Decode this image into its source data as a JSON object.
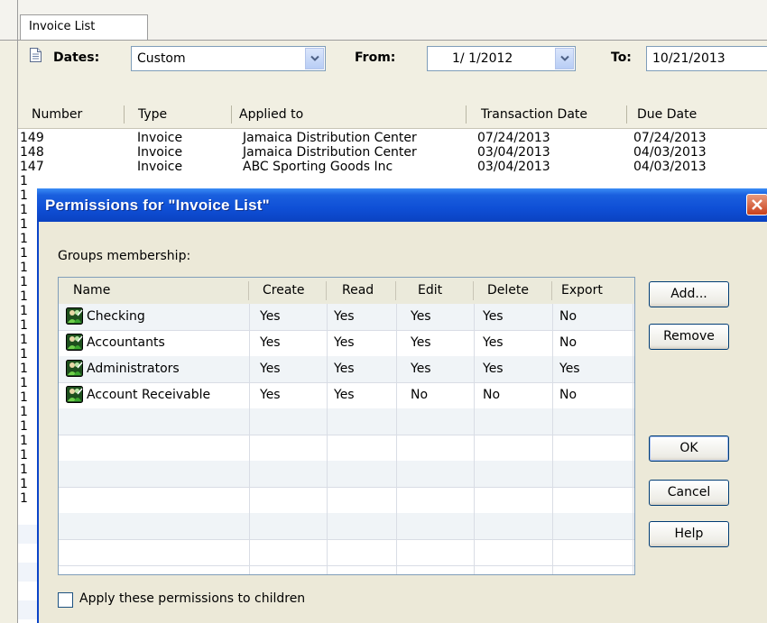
{
  "app": {
    "tab_label": "Invoice List",
    "toolbar": {
      "dates_label": "Dates:",
      "dates_value": "Custom",
      "from_label": "From:",
      "from_value": "1/ 1/2012",
      "to_label": "To:",
      "to_value": "10/21/2013"
    },
    "grid": {
      "columns": [
        "Number",
        "Type",
        "Applied to",
        "Transaction Date",
        "Due Date"
      ],
      "rows": [
        [
          "149",
          "Invoice",
          "Jamaica Distribution Center",
          "07/24/2013",
          "07/24/2013"
        ],
        [
          "148",
          "Invoice",
          "Jamaica Distribution Center",
          "03/04/2013",
          "04/03/2013"
        ],
        [
          "147",
          "Invoice",
          "ABC Sporting Goods Inc",
          "03/04/2013",
          "04/03/2013"
        ]
      ],
      "hidden_row_stub": "1"
    }
  },
  "dialog": {
    "title": "Permissions for \"Invoice List\"",
    "groups_label": "Groups membership:",
    "columns": [
      "Name",
      "Create",
      "Read",
      "Edit",
      "Delete",
      "Export"
    ],
    "rows": [
      {
        "name": "Checking",
        "create": "Yes",
        "read": "Yes",
        "edit": "Yes",
        "delete": "Yes",
        "export": "No"
      },
      {
        "name": "Accountants",
        "create": "Yes",
        "read": "Yes",
        "edit": "Yes",
        "delete": "Yes",
        "export": "No"
      },
      {
        "name": "Administrators",
        "create": "Yes",
        "read": "Yes",
        "edit": "Yes",
        "delete": "Yes",
        "export": "Yes"
      },
      {
        "name": "Account Receivable",
        "create": "Yes",
        "read": "Yes",
        "edit": "No",
        "delete": "No",
        "export": "No"
      }
    ],
    "buttons": {
      "add": "Add...",
      "remove": "Remove",
      "ok": "OK",
      "cancel": "Cancel",
      "help": "Help"
    },
    "apply_children_label": "Apply these permissions to children",
    "apply_children_checked": false
  },
  "colors": {
    "titlebar": "#0f4fd6",
    "close": "#c9401b",
    "grid_border": "#7f9db9"
  },
  "icons": {
    "group": "group-users-icon",
    "close": "close-icon",
    "dropdown": "chevron-down-icon",
    "document": "document-icon"
  }
}
